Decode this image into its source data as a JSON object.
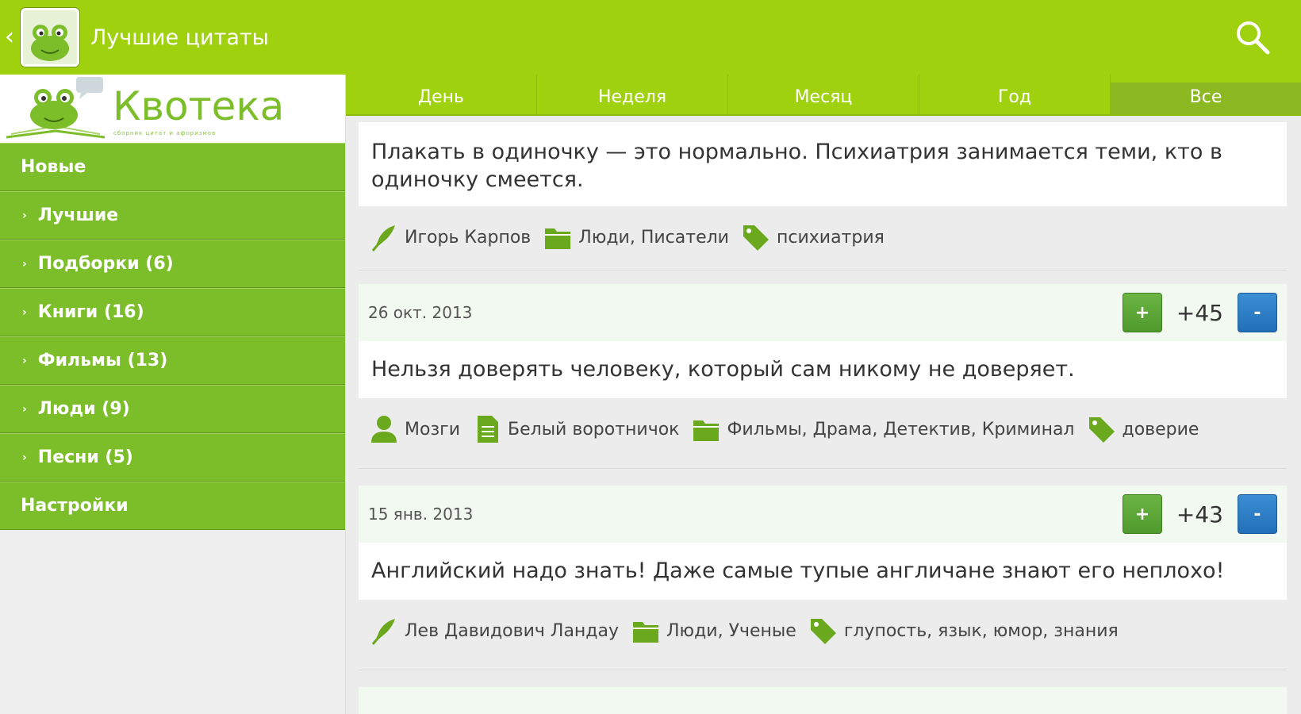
{
  "app": {
    "title": "Лучшие цитаты",
    "back_glyph": "‹",
    "icon": "frog-app-icon",
    "search_icon": "search-icon"
  },
  "sidebar": {
    "logo_text": "Квотека",
    "logo_sub": "сборник цитат и афоризмов",
    "items": [
      {
        "label": "Новые",
        "type": "section"
      },
      {
        "label": "Лучшие",
        "type": "sub"
      },
      {
        "label": "Подборки (6)",
        "type": "sub"
      },
      {
        "label": "Книги (16)",
        "type": "sub"
      },
      {
        "label": "Фильмы (13)",
        "type": "sub"
      },
      {
        "label": "Люди (9)",
        "type": "sub"
      },
      {
        "label": "Песни (5)",
        "type": "sub"
      },
      {
        "label": "Настройки",
        "type": "section"
      }
    ]
  },
  "tabs": [
    {
      "label": "День"
    },
    {
      "label": "Неделя"
    },
    {
      "label": "Месяц"
    },
    {
      "label": "Год"
    },
    {
      "label": "Все",
      "active": true
    }
  ],
  "quotes": [
    {
      "text": "Плакать в одиночку — это нормально. Психиатрия занимается теми, кто в одиночку смеется.",
      "author": "Игорь Карпов",
      "author_icon": "quill-icon",
      "categories": "Люди, Писатели",
      "tags": "психиатрия"
    },
    {
      "date": "26 окт. 2013",
      "score": "+45",
      "text": "Нельзя доверять человеку, который сам никому не доверяет.",
      "author": "Мозги",
      "author_icon": "person-icon",
      "source": "Белый воротничок",
      "categories": "Фильмы, Драма, Детектив, Криминал",
      "tags": "доверие"
    },
    {
      "date": "15 янв. 2013",
      "score": "+43",
      "text": "Английский надо знать! Даже самые тупые англичане знают его неплохо!",
      "author": "Лев Давидович Ландау",
      "author_icon": "quill-icon",
      "categories": "Люди, Ученые",
      "tags": "глупость, язык, юмор, знания"
    }
  ],
  "vote": {
    "plus": "+",
    "minus": "-"
  },
  "colors": {
    "accent": "#9fd10e",
    "menu": "#7cbd2a",
    "plus": "#4e9a2c",
    "minus": "#226fb8"
  }
}
